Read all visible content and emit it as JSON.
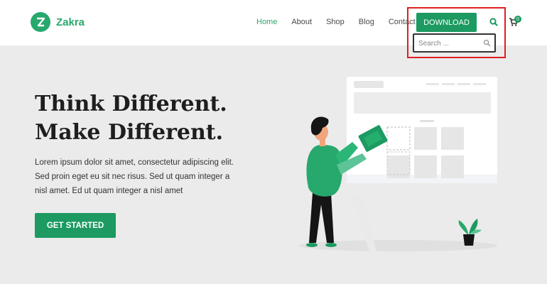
{
  "brand": {
    "name": "Zakra",
    "color": "#27a86c"
  },
  "nav": {
    "items": [
      {
        "label": "Home",
        "active": true
      },
      {
        "label": "About",
        "active": false
      },
      {
        "label": "Shop",
        "active": false
      },
      {
        "label": "Blog",
        "active": false
      },
      {
        "label": "Contact",
        "active": false
      }
    ]
  },
  "header": {
    "download_label": "DOWNLOAD",
    "search_icon": "search-icon",
    "cart_icon": "cart-icon",
    "cart_count": "0"
  },
  "search": {
    "placeholder": "Search ..."
  },
  "hero": {
    "title_line1": "Think Different.",
    "title_line2": "Make Different.",
    "text_line1": "Lorem ipsum dolor sit amet, consectetur adipiscing elit.",
    "text_line2": "Sed proin eget eu sit nec risus. Sed ut quam integer a",
    "text_line3": "nisl amet.  Ed ut quam integer a nisl amet",
    "cta_label": "GET STARTED"
  },
  "colors": {
    "accent": "#1c9a61",
    "highlight": "#e01e1e"
  }
}
